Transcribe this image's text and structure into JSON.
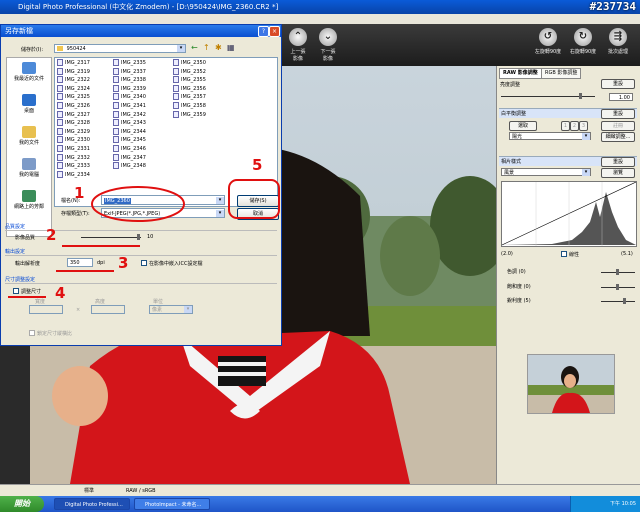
{
  "app": {
    "title": "Digital Photo Professional (中文化 Zmodem) - [D:\\950424\\IMG_2360.CR2 *]",
    "watermark": "#237734",
    "toolbar": [
      {
        "label": "上一張\n影像",
        "icon": "arrow-up-icon"
      },
      {
        "label": "下一張\n影像",
        "icon": "arrow-down-icon"
      },
      {
        "label": "左旋轉90度",
        "icon": "rotate-left-icon"
      },
      {
        "label": "右旋轉90度",
        "icon": "rotate-right-icon"
      },
      {
        "label": "批次處理",
        "icon": "batch-icon"
      }
    ]
  },
  "dialog": {
    "title": "另存新檔",
    "save_in_label": "儲存於(I):",
    "save_in_value": "950424",
    "places": [
      "我最近的文件",
      "桌面",
      "我的文件",
      "我的電腦",
      "網路上的芳鄰"
    ],
    "files": [
      [
        "IMG_2317",
        "IMG_2319",
        "IMG_2322",
        "IMG_2324",
        "IMG_2325",
        "IMG_2326",
        "IMG_2327",
        "IMG_2328",
        "IMG_2329",
        "IMG_2330",
        "IMG_2331",
        "IMG_2332",
        "IMG_2333",
        "IMG_2334"
      ],
      [
        "IMG_2335",
        "IMG_2337",
        "IMG_2338",
        "IMG_2339",
        "IMG_2340",
        "IMG_2341",
        "IMG_2342",
        "IMG_2343",
        "IMG_2344",
        "IMG_2345",
        "IMG_2346",
        "IMG_2347",
        "IMG_2348"
      ],
      [
        "IMG_2350",
        "IMG_2352",
        "IMG_2355",
        "IMG_2356",
        "IMG_2357",
        "IMG_2358",
        "IMG_2359"
      ]
    ],
    "filename_label": "檔名(N):",
    "filename_value": "IMG_2360",
    "filetype_label": "存檔類型(T):",
    "filetype_value": "Exif-JPEG(*.JPG,*.JPEG)",
    "save_button": "儲存(S)",
    "cancel_button": "取消",
    "quality_group": "品質設定",
    "quality_label": "影像品質",
    "quality_value": "10",
    "output_group": "輸出設定",
    "resolution_label": "輸出解析度",
    "resolution_value": "350",
    "resolution_unit": "dpi",
    "icc_label": "在影像中嵌入ICC設定檔",
    "resize_group": "尺寸調整設定",
    "resize_label": "調整尺寸",
    "width_label": "寬度",
    "height_label": "高度",
    "unit_label": "單位",
    "unit_value": "像素",
    "keep_ratio_label": "鎖定尺寸縱橫比"
  },
  "annotations": [
    "1",
    "2",
    "3",
    "4",
    "5"
  ],
  "right_panel": {
    "tabs": [
      "RAW 影像調整",
      "RGB 影像調整"
    ],
    "brightness_label": "亮度調整",
    "reset": "重設",
    "brightness_value": "1.00",
    "wb_label": "白平衡調整",
    "wb_click": "選取",
    "wb_nums": [
      "1",
      "2",
      "3"
    ],
    "wb_register": "註冊",
    "wb_mode": "陽光",
    "wb_fine": "細緻調整...",
    "picture_style_label": "相片樣式",
    "picture_style_value": "風景",
    "browse": "瀏覽",
    "curve_min": "(2.0)",
    "linear_label": "線性",
    "curve_max": "(5.1)",
    "sliders": [
      {
        "label": "色調",
        "value": "(0)"
      },
      {
        "label": "飽和度",
        "value": "(0)"
      },
      {
        "label": "銳利度",
        "value": "(5)"
      }
    ]
  },
  "status": {
    "left": "標準",
    "right": "RAW / sRGB"
  },
  "taskbar": {
    "start": "開始",
    "tasks": [
      "Digital Photo Professi...",
      "PhotoImpact - 未命名..."
    ],
    "clock": "下午 10:05"
  }
}
